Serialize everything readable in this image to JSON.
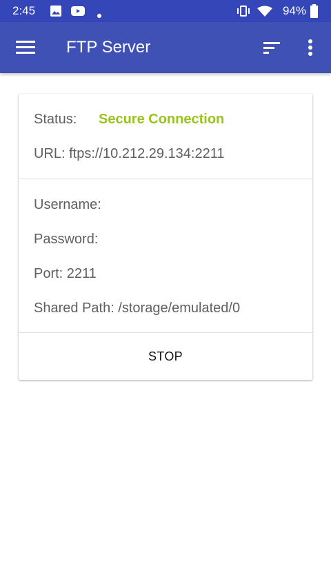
{
  "status_bar": {
    "time": "2:45",
    "battery": "94%",
    "icons": [
      "image-notification-icon",
      "youtube-notification-icon",
      "dot-icon",
      "vibrate-icon",
      "wifi-icon",
      "battery-icon"
    ]
  },
  "app_bar": {
    "title": "FTP Server",
    "menu_icon": "hamburger-menu-icon",
    "sort_icon": "sort-icon",
    "more_icon": "more-vert-icon",
    "color": "#3f51b5"
  },
  "card": {
    "status_label": "Status:",
    "status_value": "Secure Connection",
    "status_color": "#9ac31c",
    "url": "URL: ftps://10.212.29.134:2211",
    "username": "Username:",
    "password": "Password:",
    "port": "Port: 2211",
    "shared_path": "Shared Path: /storage/emulated/0",
    "stop_label": "STOP"
  }
}
